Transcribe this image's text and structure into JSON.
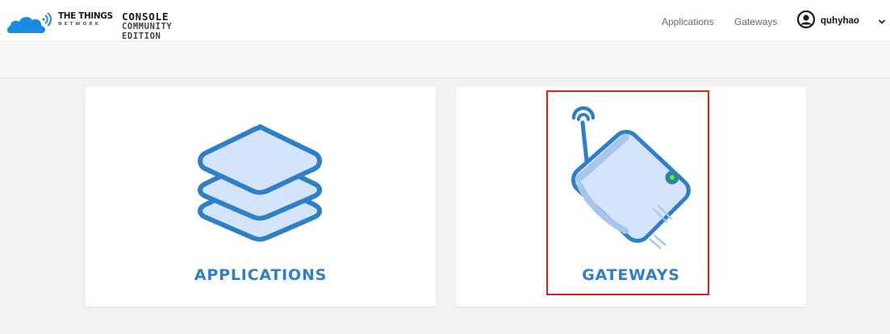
{
  "header": {
    "brand_name": "THE THINGS",
    "brand_sub": "NETWORK",
    "console_title": "CONSOLE",
    "console_edition": "COMMUNITY EDITION",
    "nav": [
      {
        "label": "Applications"
      },
      {
        "label": "Gateways"
      }
    ],
    "user": {
      "username": "quhyhao"
    }
  },
  "cards": [
    {
      "label": "APPLICATIONS",
      "icon": "stacked-layers-icon"
    },
    {
      "label": "GATEWAYS",
      "icon": "gateway-device-icon"
    }
  ],
  "colors": {
    "accent": "#2d7fc9",
    "icon_fill": "#d4e5fb",
    "page_background": "#f2f2f2",
    "highlight": "#e02020"
  }
}
